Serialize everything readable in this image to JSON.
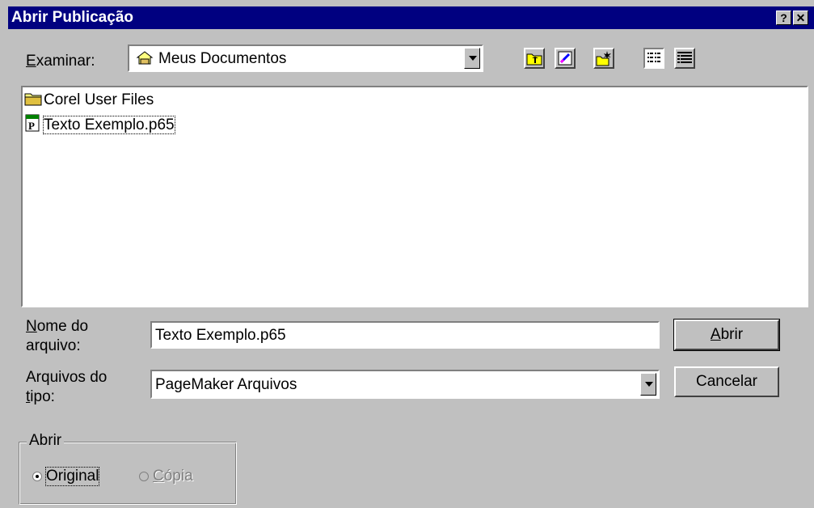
{
  "window": {
    "title": "Abrir Publicação",
    "help_glyph": "?",
    "close_glyph": "✕"
  },
  "lookin": {
    "label_first": "E",
    "label_rest": "xaminar:",
    "value": "Meus Documentos"
  },
  "toolbar": {
    "icons": [
      "up-one-level-icon",
      "favorites-icon",
      "new-folder-icon",
      "list-view-icon",
      "details-view-icon"
    ]
  },
  "files": {
    "items": [
      {
        "name": "Corel User Files",
        "icon": "folder-icon"
      },
      {
        "name": "Texto Exemplo.p65",
        "icon": "pagemaker-file-icon"
      }
    ]
  },
  "filename": {
    "label_first": "N",
    "label_line1_rest": "ome do",
    "label_line2": "arquivo:",
    "value": "Texto Exemplo.p65"
  },
  "filetype": {
    "label_line1": "Arquivos do",
    "label_line2_first": "t",
    "label_line2_rest": "ipo:",
    "value": "PageMaker Arquivos"
  },
  "buttons": {
    "open_first": "A",
    "open_rest": "brir",
    "cancel": "Cancelar"
  },
  "open_mode": {
    "legend": "Abrir",
    "original_label": "Original",
    "copy_first": "C",
    "copy_rest": "ópia"
  },
  "colors": {
    "titlebar": "#000080",
    "face": "#c0c0c0"
  }
}
